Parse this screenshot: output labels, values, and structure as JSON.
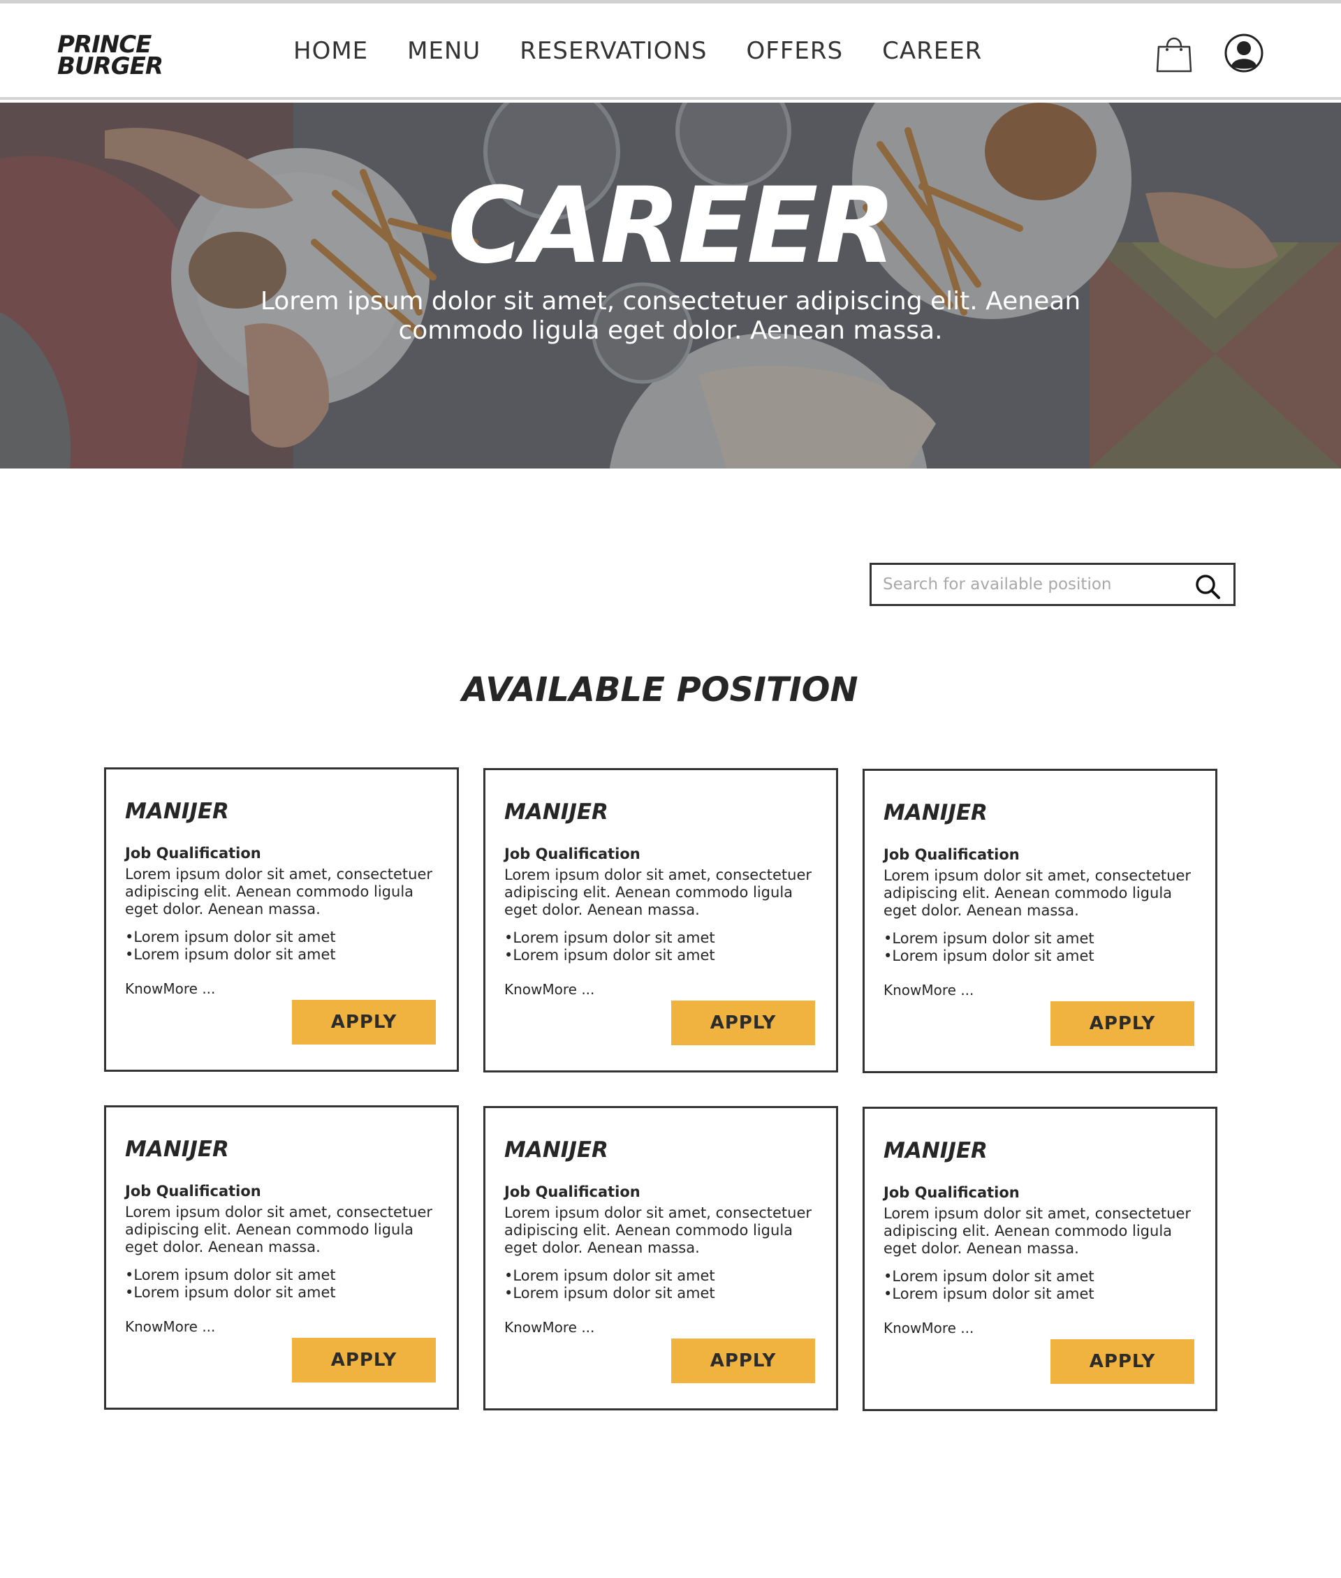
{
  "brand": {
    "line1": "PRINCE",
    "line2": "BURGER"
  },
  "nav": [
    "HOME",
    "MENU",
    "RESERVATIONS",
    "OFFERS",
    "CAREER"
  ],
  "hero": {
    "title": "CAREER",
    "subtitle": "Lorem ipsum dolor sit amet, consectetuer adipiscing elit. Aenean commodo ligula eget dolor. Aenean massa."
  },
  "search": {
    "placeholder": "Search for available position",
    "value": ""
  },
  "section_title": "AVAILABLE POSITION",
  "positions": [
    {
      "title": "MANIJER",
      "qualification_label": "Job Qualification",
      "description": "Lorem ipsum dolor sit amet, consectetuer adipiscing elit. Aenean commodo ligula eget dolor. Aenean massa.",
      "bullets": [
        "•Lorem ipsum dolor sit amet",
        "•Lorem ipsum dolor sit amet"
      ],
      "more_label": "KnowMore ...",
      "apply_label": "APPLY"
    },
    {
      "title": "MANIJER",
      "qualification_label": "Job Qualification",
      "description": "Lorem ipsum dolor sit amet, consectetuer adipiscing elit. Aenean commodo ligula eget dolor. Aenean massa.",
      "bullets": [
        "•Lorem ipsum dolor sit amet",
        "•Lorem ipsum dolor sit amet"
      ],
      "more_label": "KnowMore ...",
      "apply_label": "APPLY"
    },
    {
      "title": "MANIJER",
      "qualification_label": "Job Qualification",
      "description": "Lorem ipsum dolor sit amet, consectetuer adipiscing elit. Aenean commodo ligula eget dolor. Aenean massa.",
      "bullets": [
        "•Lorem ipsum dolor sit amet",
        "•Lorem ipsum dolor sit amet"
      ],
      "more_label": "KnowMore ...",
      "apply_label": "APPLY"
    },
    {
      "title": "MANIJER",
      "qualification_label": "Job Qualification",
      "description": "Lorem ipsum dolor sit amet, consectetuer adipiscing elit. Aenean commodo ligula eget dolor. Aenean massa.",
      "bullets": [
        "•Lorem ipsum dolor sit amet",
        "•Lorem ipsum dolor sit amet"
      ],
      "more_label": "KnowMore ...",
      "apply_label": "APPLY"
    },
    {
      "title": "MANIJER",
      "qualification_label": "Job Qualification",
      "description": "Lorem ipsum dolor sit amet, consectetuer adipiscing elit. Aenean commodo ligula eget dolor. Aenean massa.",
      "bullets": [
        "•Lorem ipsum dolor sit amet",
        "•Lorem ipsum dolor sit amet"
      ],
      "more_label": "KnowMore ...",
      "apply_label": "APPLY"
    },
    {
      "title": "MANIJER",
      "qualification_label": "Job Qualification",
      "description": "Lorem ipsum dolor sit amet, consectetuer adipiscing elit. Aenean commodo ligula eget dolor. Aenean massa.",
      "bullets": [
        "•Lorem ipsum dolor sit amet",
        "•Lorem ipsum dolor sit amet"
      ],
      "more_label": "KnowMore ...",
      "apply_label": "APPLY"
    }
  ],
  "icons": {
    "cart": "shopping-bag-icon",
    "account": "user-account-icon",
    "search": "search-icon"
  },
  "colors": {
    "accent": "#f1b33f",
    "text": "#262626",
    "border": "#333333"
  }
}
